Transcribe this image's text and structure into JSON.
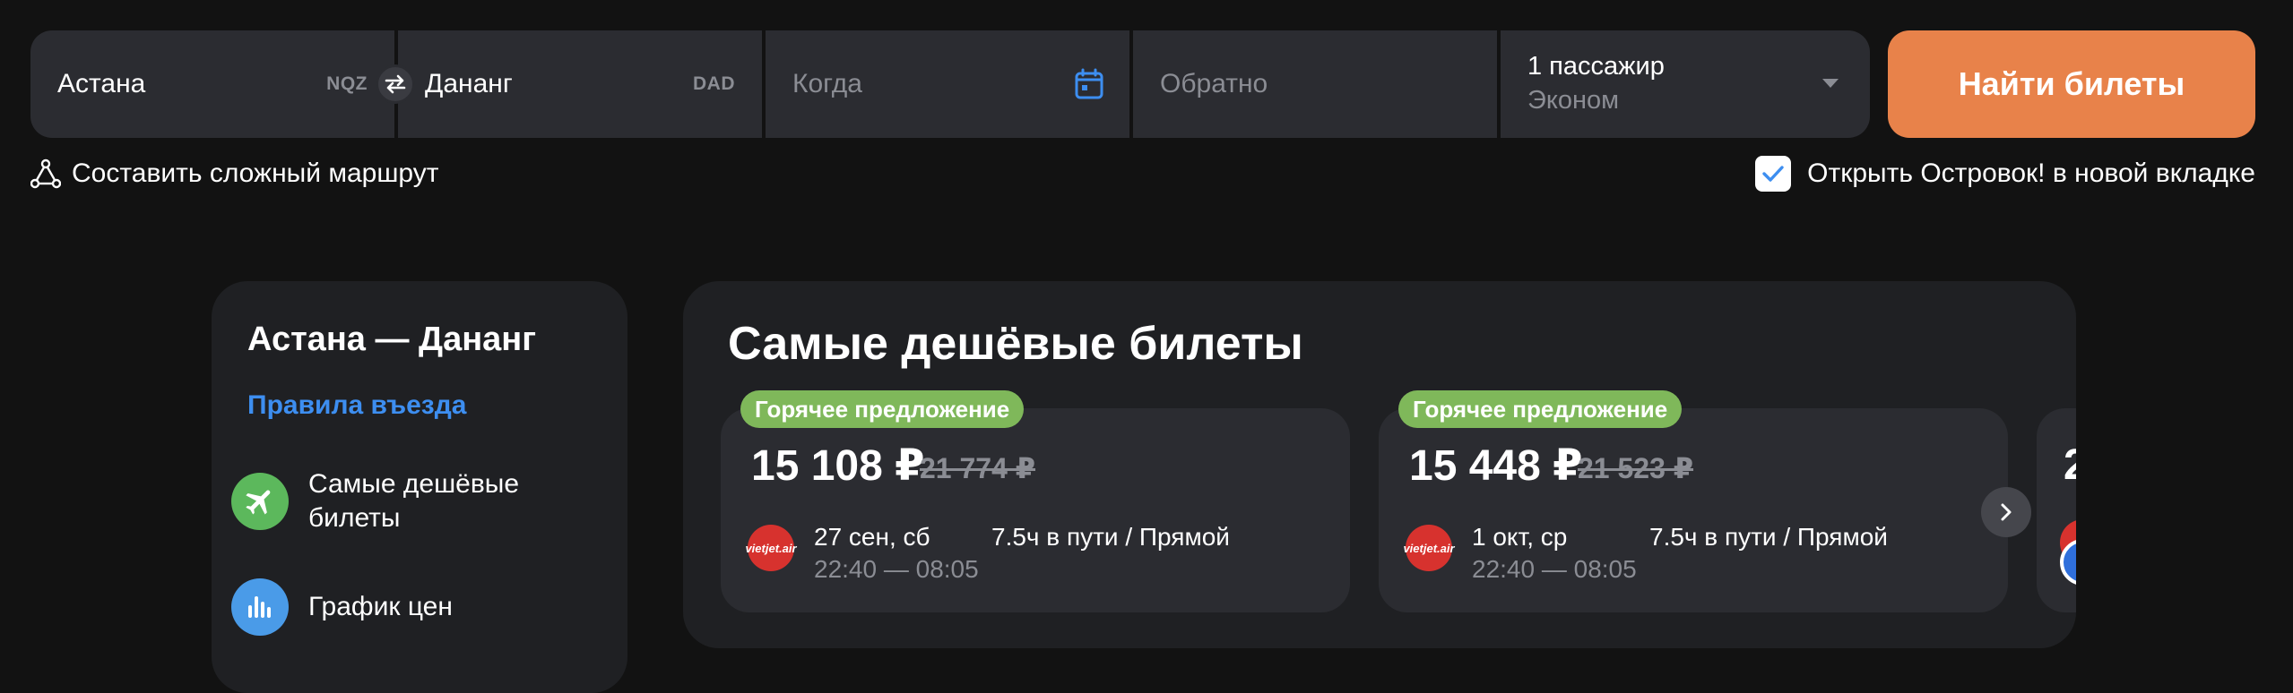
{
  "search": {
    "from_value": "Астана",
    "from_code": "NQZ",
    "to_value": "Дананг",
    "to_code": "DAD",
    "when_placeholder": "Когда",
    "return_placeholder": "Обратно",
    "passengers": "1 пассажир",
    "cabin_class": "Эконом",
    "search_button_label": "Найти билеты"
  },
  "options": {
    "complex_route_label": "Составить сложный маршрут",
    "new_tab_label": "Открыть Островок! в новой вкладке",
    "new_tab_checked": true
  },
  "sidebar": {
    "title": "Астана — Дананг",
    "entry_rules_link": "Правила въезда",
    "items": [
      {
        "label": "Самые дешёвые билеты",
        "icon": "plane-icon",
        "color": "#5cb85c"
      },
      {
        "label": "График цен",
        "icon": "bar-chart-icon",
        "color": "#4a9be8"
      }
    ]
  },
  "cheapest": {
    "title": "Самые дешёвые билеты",
    "cards": [
      {
        "badge": "Горячее предложение",
        "price": "15 108 ₽",
        "old_price": "21 774 ₽",
        "airline_logo_text": "vietjet.air",
        "date": "27 сен, сб",
        "times": "22:40 — 08:05",
        "duration": "7.5ч в пути",
        "stops": "Прямой"
      },
      {
        "badge": "Горячее предложение",
        "price": "15 448 ₽",
        "old_price": "21 523 ₽",
        "airline_logo_text": "vietjet.air",
        "date": "1 окт, ср",
        "times": "22:40 — 08:05",
        "duration": "7.5ч в пути",
        "stops": "Прямой"
      }
    ],
    "peek_card_price": "2"
  },
  "colors": {
    "background": "#121212",
    "field_bg": "#2b2c31",
    "accent_orange": "#e8824a",
    "link_blue": "#3d8ef0",
    "badge_green": "#7fb85a"
  }
}
